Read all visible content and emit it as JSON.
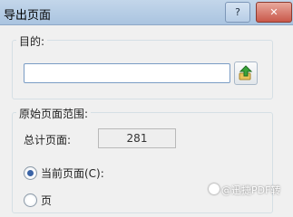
{
  "window": {
    "title": "导出页面"
  },
  "caption_buttons": {
    "help": "?",
    "close": "✕"
  },
  "target": {
    "legend": "目的:",
    "path_value": "",
    "browse_icon": "green-up-arrow-icon"
  },
  "range": {
    "legend": "原始页面范围:",
    "total_label": "总计页面:",
    "total_value": "281",
    "current_page_label": "当前页面(C):",
    "second_option_label": "页"
  },
  "watermark": {
    "text": "@迅捷PDF转"
  }
}
